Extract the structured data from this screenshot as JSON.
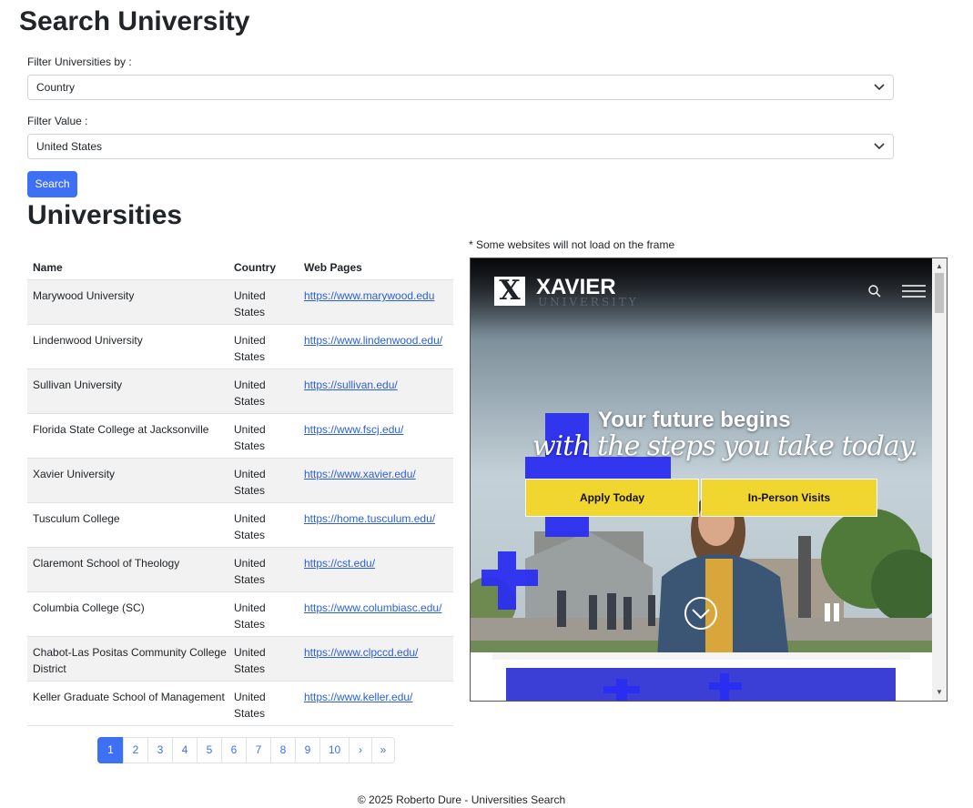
{
  "header": {
    "title": "Search University"
  },
  "filter": {
    "by_label": "Filter Universities by :",
    "by_value": "Country",
    "value_label": "Filter Value :",
    "value_value": "United States",
    "search_label": "Search"
  },
  "results": {
    "title": "Universities",
    "columns": [
      "Name",
      "Country",
      "Web Pages"
    ],
    "rows": [
      {
        "name": "Marywood University",
        "country": "United States",
        "web": "https://www.marywood.edu"
      },
      {
        "name": "Lindenwood University",
        "country": "United States",
        "web": "https://www.lindenwood.edu/"
      },
      {
        "name": "Sullivan University",
        "country": "United States",
        "web": "https://sullivan.edu/"
      },
      {
        "name": "Florida State College at Jacksonville",
        "country": "United States",
        "web": "https://www.fscj.edu/"
      },
      {
        "name": "Xavier University",
        "country": "United States",
        "web": "https://www.xavier.edu/"
      },
      {
        "name": "Tusculum College",
        "country": "United States",
        "web": "https://home.tusculum.edu/"
      },
      {
        "name": "Claremont School of Theology",
        "country": "United States",
        "web": "https://cst.edu/"
      },
      {
        "name": "Columbia College (SC)",
        "country": "United States",
        "web": "https://www.columbiasc.edu/"
      },
      {
        "name": "Chabot-Las Positas Community College District",
        "country": "United States",
        "web": "https://www.clpccd.edu/"
      },
      {
        "name": "Keller Graduate School of Management",
        "country": "United States",
        "web": "https://www.keller.edu/"
      }
    ]
  },
  "pagination": {
    "pages": [
      "1",
      "2",
      "3",
      "4",
      "5",
      "6",
      "7",
      "8",
      "9",
      "10"
    ],
    "active": "1",
    "next": "›",
    "last": "»"
  },
  "preview": {
    "note": "* Some websites will not load on the frame",
    "site": {
      "logo_mark": "X",
      "logo_name": "XAVIER",
      "logo_sub": "UNIVERSITY",
      "headline": "Your future begins",
      "tagline": "with the steps you take today.",
      "button_apply": "Apply Today",
      "button_visit": "In-Person Visits",
      "accent_color": "#2a2ef0",
      "button_color": "#f2d630"
    }
  },
  "footer": {
    "text": "© 2025 Roberto Dure - Universities Search"
  },
  "colors": {
    "primary": "#3d70f2",
    "link": "#2b5fd9",
    "stripe": "#f2f2f2"
  }
}
